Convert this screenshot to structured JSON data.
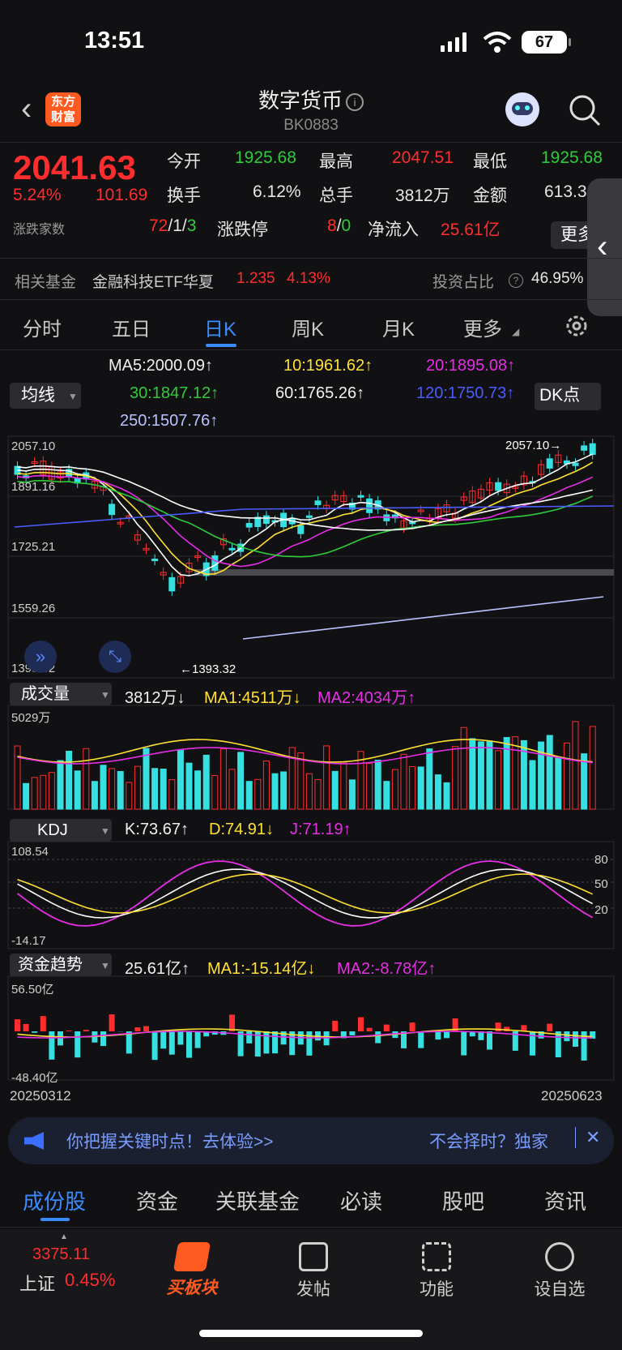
{
  "status": {
    "time": "13:51",
    "battery": "67"
  },
  "nav": {
    "logo_line1": "东方",
    "logo_line2": "财富",
    "title": "数字货币",
    "code": "BK0883"
  },
  "quote": {
    "price": "2041.63",
    "change_pct": "5.24%",
    "change": "101.69",
    "open_label": "今开",
    "open": "1925.68",
    "high_label": "最高",
    "high": "2047.51",
    "low_label": "最低",
    "low": "1925.68",
    "turnover_label": "换手",
    "turnover": "6.12%",
    "volume_label": "总手",
    "volume": "3812万",
    "amount_label": "金额",
    "amount": "613.3",
    "breadth_label": "涨跌家数",
    "up": "72",
    "flat": "1",
    "down": "3",
    "sep": "/",
    "limit_label": "涨跌停",
    "limit_up": "8",
    "limit_down": "0",
    "netflow_label": "净流入",
    "netflow": "25.61亿",
    "more": "更多"
  },
  "fund": {
    "label": "相关基金",
    "name": "金融科技ETF华夏",
    "price": "1.235",
    "pct": "4.13%",
    "ratio_label": "投资占比",
    "ratio": "46.95%"
  },
  "tabs": [
    "分时",
    "五日",
    "日K",
    "周K",
    "月K",
    "更多"
  ],
  "ma": {
    "selector": "均线",
    "dk": "DK点",
    "ma5": "MA5:2000.09",
    "ma10": "10:1961.62",
    "ma20": "20:1895.08",
    "ma30": "30:1847.12",
    "ma60": "60:1765.26",
    "ma120": "120:1750.73",
    "ma250": "250:1507.76",
    "up": "↑",
    "down": "↓"
  },
  "price_axis": [
    "2057.10",
    "1891.16",
    "1725.21",
    "1559.26",
    "1393.32"
  ],
  "high_marker": "2057.10",
  "low_marker": "1393.32",
  "volume": {
    "selector": "成交量",
    "value": "3812万",
    "ma1": "MA1:4511万",
    "ma2": "MA2:4034万",
    "axis_max": "5029万"
  },
  "kdj": {
    "selector": "KDJ",
    "k": "K:73.67",
    "d": "D:74.91",
    "j": "J:71.19",
    "axis_top": "108.54",
    "axis_bottom": "-14.17",
    "levels": [
      "80",
      "50",
      "20"
    ]
  },
  "funds": {
    "selector": "资金趋势",
    "value": "25.61亿",
    "ma1": "MA1:-15.14亿",
    "ma2": "MA2:-8.78亿",
    "axis_top": "56.50亿",
    "axis_bottom": "-48.40亿"
  },
  "dates": {
    "start": "20250312",
    "end": "20250623"
  },
  "banner": {
    "text": "你把握关键时点！去体验>>",
    "right": "不会择时？独家"
  },
  "bottom_tabs": [
    "成份股",
    "资金",
    "关联基金",
    "必读",
    "股吧",
    "资讯"
  ],
  "bottom_nav": {
    "index_value": "3375.11",
    "index_name": "上证",
    "index_pct": "0.45%",
    "buy": "买板块",
    "post": "发帖",
    "func": "功能",
    "watch": "设自选"
  },
  "colors": {
    "up": "#ff2d2d",
    "down": "#2ecc3a",
    "bar_down": "#36dfe0",
    "accent": "#3a8bff",
    "ma5": "#ffffff",
    "ma10": "#ffe033",
    "ma20": "#e62ee6",
    "ma30": "#2ecc3a",
    "ma60": "#ffffff",
    "ma120": "#4a5cff",
    "ma250": "#b9c3ff"
  }
}
